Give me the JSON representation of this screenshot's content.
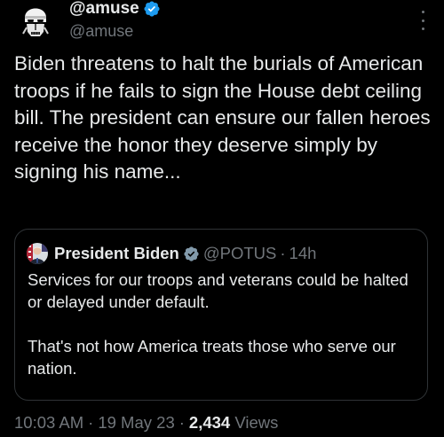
{
  "author": {
    "display_name": "@amuse",
    "handle": "@amuse",
    "avatar_icon": "stormtrooper-avatar-icon",
    "verified_color": "#1d9bf0"
  },
  "tweet": {
    "text": "Biden threatens to halt the burials of American troops if he fails to sign the House debt ceiling bill. The president can ensure our fallen heroes receive the honor they deserve simply by signing his name..."
  },
  "quoted_tweet": {
    "display_name": "President Biden",
    "handle": "@POTUS",
    "separator": "·",
    "time": "14h",
    "text": "Services for our troops and veterans could be halted or delayed under default.\n\nThat's not how America treats those who serve our nation.",
    "verified_color": "#829aab"
  },
  "meta": {
    "time": "10:03 AM",
    "separator": "·",
    "date": "19 May 23",
    "views_count": "2,434",
    "views_label": "Views"
  }
}
